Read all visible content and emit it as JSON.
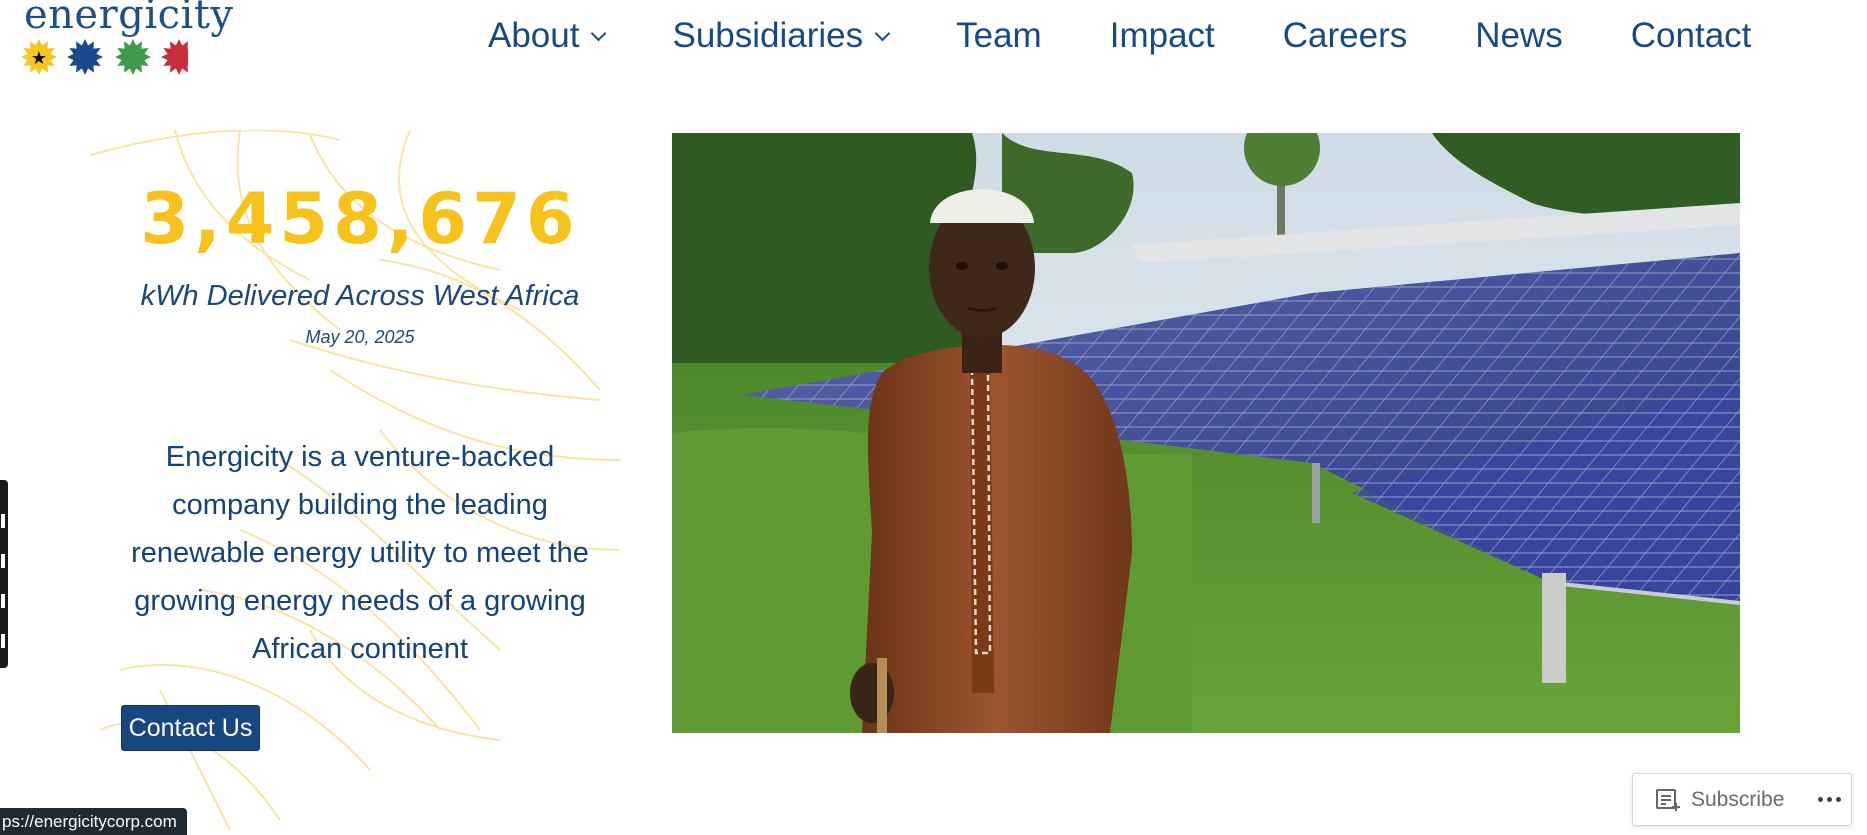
{
  "logo": {
    "text": "energicity",
    "icon": "sunburst-logo-icon",
    "colors": [
      "#f7c51e",
      "#1b4a8c",
      "#3f9a49",
      "#c7303a"
    ]
  },
  "nav": {
    "items": [
      {
        "label": "About",
        "has_dropdown": true
      },
      {
        "label": "Subsidiaries",
        "has_dropdown": true
      },
      {
        "label": "Team"
      },
      {
        "label": "Impact"
      },
      {
        "label": "Careers"
      },
      {
        "label": "News"
      },
      {
        "label": "Contact"
      }
    ]
  },
  "hero": {
    "kwh_value": "3,458,676",
    "kwh_label": "kWh Delivered Across West Africa",
    "kwh_date": "May 20, 2025",
    "intro": "Energicity is a venture-backed company building the leading renewable energy utility to meet the growing energy needs of a growing African continent",
    "cta_label": "Contact Us",
    "photo_icon": "solar-panels-photo"
  },
  "status_url": "ps://energicitycorp.com",
  "subscribe": {
    "label": "Subscribe",
    "icon": "reader-add-icon",
    "more_icon": "ellipsis-icon"
  },
  "colors": {
    "brand_navy": "#174680",
    "brand_yellow": "#f6c21b",
    "pattern_yellow": "#f9e3a6"
  }
}
